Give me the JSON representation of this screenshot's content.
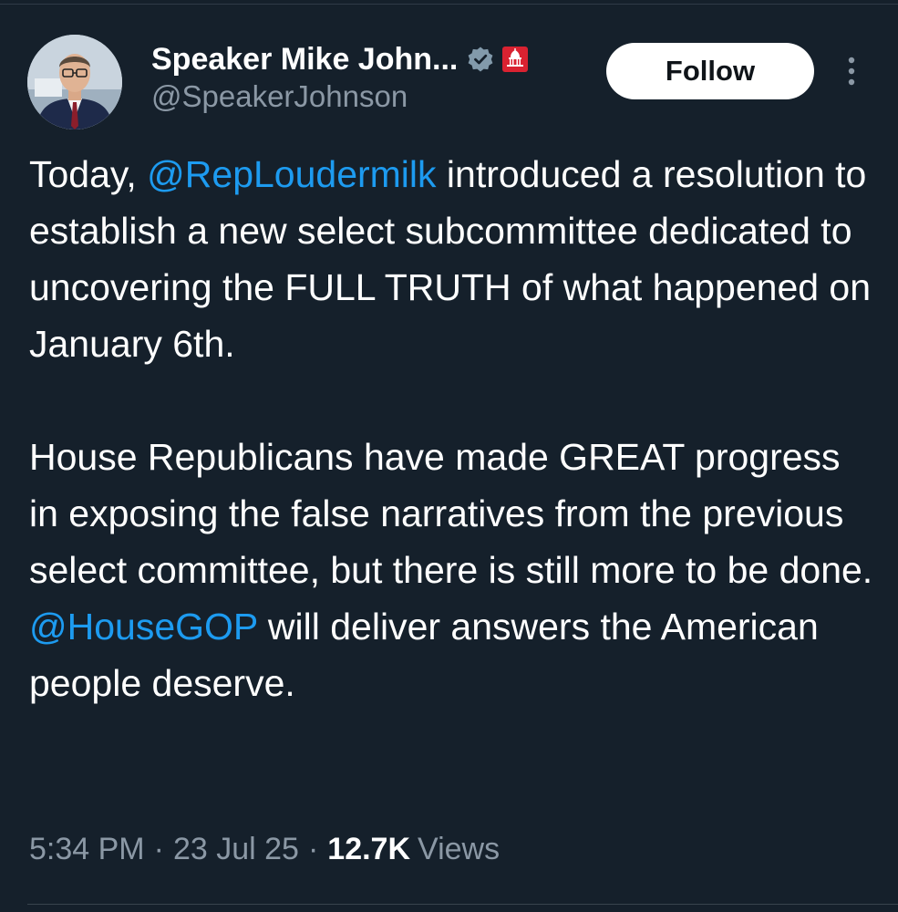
{
  "author": {
    "display_name": "Speaker Mike John...",
    "handle": "@SpeakerJohnson",
    "verified_badge_color": "#829aab",
    "affiliate_badge_color": "#d92231"
  },
  "follow_label": "Follow",
  "tweet": {
    "p1": {
      "pre": "Today, ",
      "mention": "@RepLoudermilk",
      "post": " introduced a resolution to establish a new select subcommittee dedicated to uncovering the FULL TRUTH of what happened on January 6th."
    },
    "p2": {
      "pre": "House Republicans have made GREAT progress in exposing the false narratives from the previous select committee, but there is still more to be done. ",
      "mention": "@HouseGOP",
      "post": " will deliver answers the American people deserve."
    }
  },
  "meta": {
    "time": "5:34 PM",
    "separator": "·",
    "date": "23 Jul 25",
    "views_count": "12.7K",
    "views_label": "Views"
  },
  "colors": {
    "background": "#15202b",
    "link": "#1d9bf0",
    "secondary_text": "#8b98a5"
  }
}
